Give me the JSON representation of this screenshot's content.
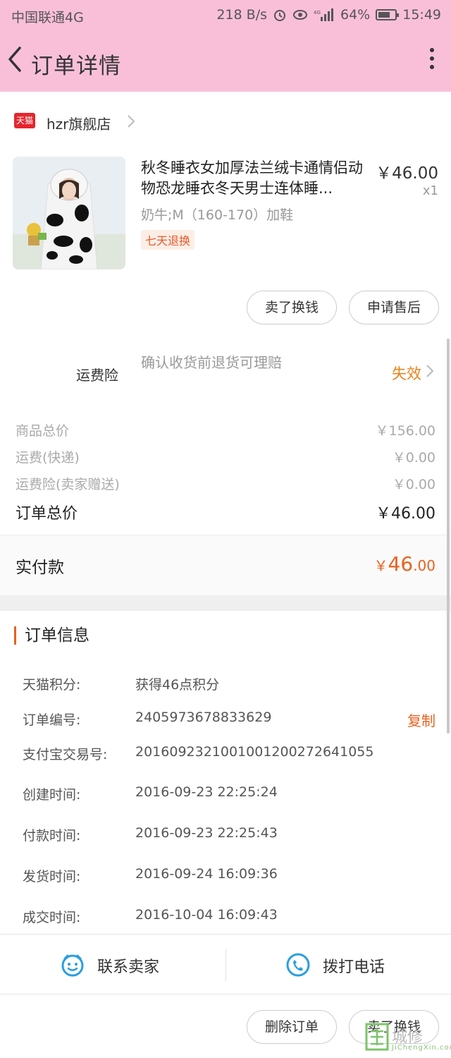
{
  "status_bar": {
    "carrier": "中国联通4G",
    "net_speed": "218 B/s",
    "battery": "64%",
    "time": "15:49"
  },
  "nav": {
    "title": "订单详情"
  },
  "store": {
    "logo_text": "天猫",
    "name": "hzr旗舰店"
  },
  "product": {
    "title": "秋冬睡衣女加厚法兰绒卡通情侣动物恐龙睡衣冬天男士连体睡...",
    "sku": "奶牛;M（160-170）加鞋",
    "tag": "七天退换",
    "price": "￥46.00",
    "qty": "x1"
  },
  "item_actions": {
    "sell": "卖了换钱",
    "after_sale": "申请售后"
  },
  "insurance": {
    "label": "运费险",
    "desc": "确认收货前退货可理赔",
    "status": "失效"
  },
  "summary": [
    {
      "label": "商品总价",
      "value": "￥156.00"
    },
    {
      "label": "运费(快递)",
      "value": "￥0.00"
    },
    {
      "label": "运费险(卖家赠送)",
      "value": "￥0.00"
    }
  ],
  "order_total": {
    "label": "订单总价",
    "value": "￥46.00"
  },
  "paid": {
    "label": "实付款",
    "currency": "￥",
    "integer": "46",
    "decimal": ".00"
  },
  "info": {
    "title": "订单信息",
    "copy_label": "复制",
    "rows": [
      {
        "label": "天猫积分:",
        "value": "获得46点积分"
      },
      {
        "label": "订单编号:",
        "value": "2405973678833629"
      },
      {
        "label": "支付宝交易号:",
        "value": "2016092321001001200272641055"
      },
      {
        "label": "创建时间:",
        "value": "2016-09-23 22:25:24"
      },
      {
        "label": "付款时间:",
        "value": "2016-09-23 22:25:43"
      },
      {
        "label": "发货时间:",
        "value": "2016-09-24 16:09:36"
      },
      {
        "label": "成交时间:",
        "value": "2016-10-04 16:09:43"
      }
    ]
  },
  "contact": {
    "seller": "联系卖家",
    "call": "拨打电话"
  },
  "bottom_actions": {
    "delete": "删除订单",
    "sell": "卖了换钱"
  },
  "watermark": {
    "text": "城修",
    "sub": "JiChengXin.com"
  },
  "colors": {
    "header_bg": "#f9bfd9",
    "accent": "#e8611e",
    "status_warn": "#e8831a",
    "tmall_red": "#e4262e"
  }
}
